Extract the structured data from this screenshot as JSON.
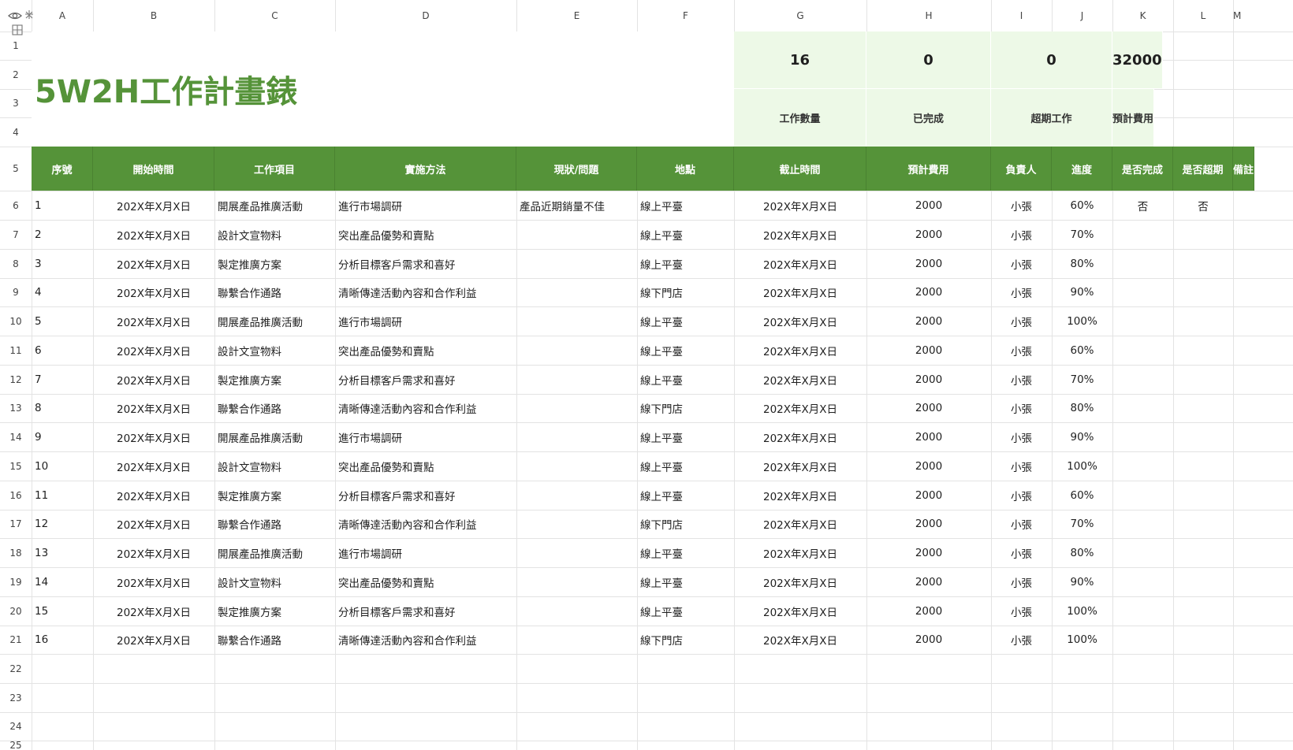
{
  "columns": [
    "A",
    "B",
    "C",
    "D",
    "E",
    "F",
    "G",
    "H",
    "I",
    "J",
    "K",
    "L",
    "M"
  ],
  "row_numbers": [
    "1",
    "2",
    "3",
    "4",
    "5",
    "6",
    "7",
    "8",
    "9",
    "10",
    "11",
    "12",
    "13",
    "14",
    "15",
    "16",
    "17",
    "18",
    "19",
    "20",
    "21",
    "22",
    "23",
    "24",
    "25"
  ],
  "title": "5W2H工作計畫錶",
  "stats": [
    {
      "value": "16",
      "label": "工作數量"
    },
    {
      "value": "0",
      "label": "已完成"
    },
    {
      "value": "0",
      "label": "超期工作"
    },
    {
      "value": "32000",
      "label": "預計費用"
    }
  ],
  "headers": [
    "序號",
    "開始時間",
    "工作項目",
    "實施方法",
    "現狀/問題",
    "地點",
    "截止時間",
    "預計費用",
    "負責人",
    "進度",
    "是否完成",
    "是否超期",
    "備註"
  ],
  "rows": [
    [
      "1",
      "202X年X月X日",
      "開展產品推廣活動",
      "進行市場調研",
      "產品近期銷量不佳",
      "線上平臺",
      "202X年X月X日",
      "2000",
      "小張",
      "60%",
      "否",
      "否",
      ""
    ],
    [
      "2",
      "202X年X月X日",
      "設計文宣物料",
      "突出產品優勢和賣點",
      "",
      "線上平臺",
      "202X年X月X日",
      "2000",
      "小張",
      "70%",
      "",
      "",
      ""
    ],
    [
      "3",
      "202X年X月X日",
      "製定推廣方案",
      "分析目標客戶需求和喜好",
      "",
      "線上平臺",
      "202X年X月X日",
      "2000",
      "小張",
      "80%",
      "",
      "",
      ""
    ],
    [
      "4",
      "202X年X月X日",
      "聯繫合作通路",
      "清晰傳達活動內容和合作利益",
      "",
      "線下門店",
      "202X年X月X日",
      "2000",
      "小張",
      "90%",
      "",
      "",
      ""
    ],
    [
      "5",
      "202X年X月X日",
      "開展產品推廣活動",
      "進行市場調研",
      "",
      "線上平臺",
      "202X年X月X日",
      "2000",
      "小張",
      "100%",
      "",
      "",
      ""
    ],
    [
      "6",
      "202X年X月X日",
      "設計文宣物料",
      "突出產品優勢和賣點",
      "",
      "線上平臺",
      "202X年X月X日",
      "2000",
      "小張",
      "60%",
      "",
      "",
      ""
    ],
    [
      "7",
      "202X年X月X日",
      "製定推廣方案",
      "分析目標客戶需求和喜好",
      "",
      "線上平臺",
      "202X年X月X日",
      "2000",
      "小張",
      "70%",
      "",
      "",
      ""
    ],
    [
      "8",
      "202X年X月X日",
      "聯繫合作通路",
      "清晰傳達活動內容和合作利益",
      "",
      "線下門店",
      "202X年X月X日",
      "2000",
      "小張",
      "80%",
      "",
      "",
      ""
    ],
    [
      "9",
      "202X年X月X日",
      "開展產品推廣活動",
      "進行市場調研",
      "",
      "線上平臺",
      "202X年X月X日",
      "2000",
      "小張",
      "90%",
      "",
      "",
      ""
    ],
    [
      "10",
      "202X年X月X日",
      "設計文宣物料",
      "突出產品優勢和賣點",
      "",
      "線上平臺",
      "202X年X月X日",
      "2000",
      "小張",
      "100%",
      "",
      "",
      ""
    ],
    [
      "11",
      "202X年X月X日",
      "製定推廣方案",
      "分析目標客戶需求和喜好",
      "",
      "線上平臺",
      "202X年X月X日",
      "2000",
      "小張",
      "60%",
      "",
      "",
      ""
    ],
    [
      "12",
      "202X年X月X日",
      "聯繫合作通路",
      "清晰傳達活動內容和合作利益",
      "",
      "線下門店",
      "202X年X月X日",
      "2000",
      "小張",
      "70%",
      "",
      "",
      ""
    ],
    [
      "13",
      "202X年X月X日",
      "開展產品推廣活動",
      "進行市場調研",
      "",
      "線上平臺",
      "202X年X月X日",
      "2000",
      "小張",
      "80%",
      "",
      "",
      ""
    ],
    [
      "14",
      "202X年X月X日",
      "設計文宣物料",
      "突出產品優勢和賣點",
      "",
      "線上平臺",
      "202X年X月X日",
      "2000",
      "小張",
      "90%",
      "",
      "",
      ""
    ],
    [
      "15",
      "202X年X月X日",
      "製定推廣方案",
      "分析目標客戶需求和喜好",
      "",
      "線上平臺",
      "202X年X月X日",
      "2000",
      "小張",
      "100%",
      "",
      "",
      ""
    ],
    [
      "16",
      "202X年X月X日",
      "聯繫合作通路",
      "清晰傳達活動內容和合作利益",
      "",
      "線下門店",
      "202X年X月X日",
      "2000",
      "小張",
      "100%",
      "",
      "",
      ""
    ]
  ],
  "colors": {
    "accent": "#559339",
    "stat_bg": "#edf9e7",
    "grid": "#e3e3e3"
  },
  "icons": {
    "corner_top": "eye-icon",
    "corner_secondary": "freeze-icon"
  }
}
